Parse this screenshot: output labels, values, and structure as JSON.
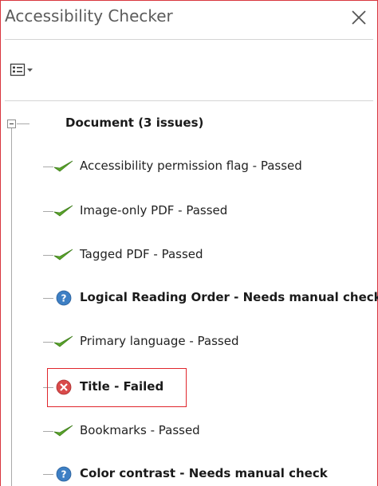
{
  "panel": {
    "title": "Accessibility Checker"
  },
  "toolbar": {
    "options_icon": "options-list-icon",
    "dropdown_icon": "caret-down-icon"
  },
  "tree": {
    "root_label": "Document (3 issues)",
    "items": [
      {
        "label": "Accessibility permission flag - Passed",
        "status": "passed",
        "icon": "check-icon"
      },
      {
        "label": "Image-only PDF - Passed",
        "status": "passed",
        "icon": "check-icon"
      },
      {
        "label": "Tagged PDF - Passed",
        "status": "passed",
        "icon": "check-icon"
      },
      {
        "label": "Logical Reading Order - Needs manual check",
        "status": "needs-manual-check",
        "icon": "question-icon"
      },
      {
        "label": "Primary language - Passed",
        "status": "passed",
        "icon": "check-icon"
      },
      {
        "label": "Title - Failed",
        "status": "failed",
        "icon": "error-icon"
      },
      {
        "label": "Bookmarks - Passed",
        "status": "passed",
        "icon": "check-icon"
      },
      {
        "label": "Color contrast - Needs manual check",
        "status": "needs-manual-check",
        "icon": "question-icon"
      }
    ]
  },
  "colors": {
    "pass_green": "#5aa42a",
    "question_blue": "#3d7fc4",
    "fail_red": "#d94a4a",
    "highlight_red": "#e0262c"
  }
}
